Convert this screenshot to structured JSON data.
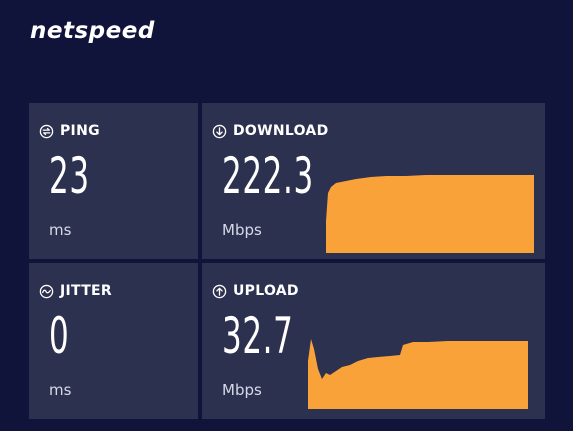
{
  "app": {
    "logo_text": "netspeed"
  },
  "colors": {
    "background": "#10143a",
    "card": "#2d3150",
    "graph": "#f9a23a",
    "text": "#ffffff"
  },
  "ping": {
    "icon": "ping-icon",
    "label": "PING",
    "value": "23",
    "unit": "ms"
  },
  "download": {
    "icon": "download-arrow-icon",
    "label": "DOWNLOAD",
    "value": "222.3",
    "unit": "Mbps"
  },
  "jitter": {
    "icon": "jitter-icon",
    "label": "JITTER",
    "value": "0",
    "unit": "ms"
  },
  "upload": {
    "icon": "upload-arrow-icon",
    "label": "UPLOAD",
    "value": "32.7",
    "unit": "Mbps"
  }
}
